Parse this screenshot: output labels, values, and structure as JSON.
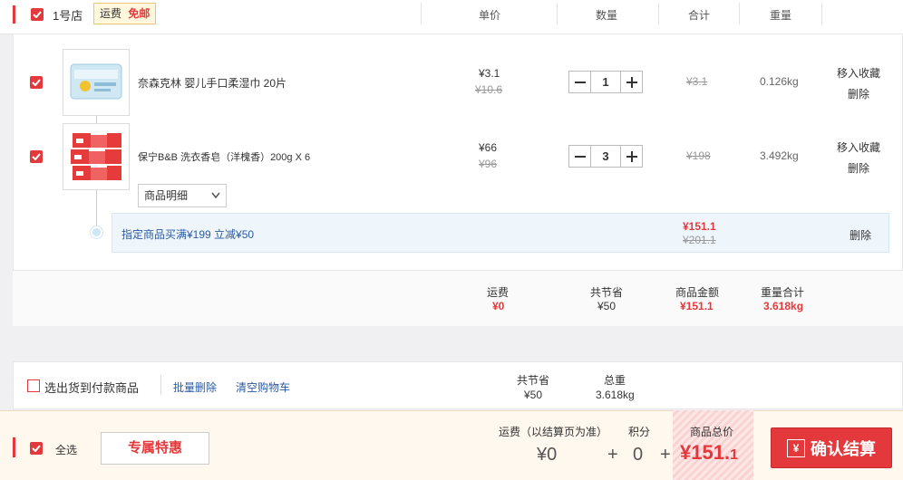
{
  "header": {
    "store_name": "1号店",
    "shipping_badge_label": "运费",
    "shipping_badge_value": "免邮",
    "col_price": "单价",
    "col_qty": "数量",
    "col_total": "合计",
    "col_weight": "重量"
  },
  "items": [
    {
      "name": "奈森克林 婴儿手口柔湿巾 20片",
      "price": "¥3.1",
      "orig_price": "¥10.6",
      "qty": "1",
      "total_strike": "¥3.1",
      "weight": "0.126kg",
      "fav_label": "移入收藏",
      "del_label": "删除"
    },
    {
      "name": "保宁B&B 洗衣香皂（洋槐香）200g X 6",
      "price": "¥66",
      "orig_price": "¥96",
      "qty": "3",
      "total_strike": "¥198",
      "weight": "3.492kg",
      "fav_label": "移入收藏",
      "del_label": "删除"
    }
  ],
  "detail_dropdown": "商品明细",
  "promo": {
    "text": "指定商品买满¥199 立减¥50",
    "price": "¥151.1",
    "orig_price": "¥201.1",
    "delete": "删除"
  },
  "store_summary": {
    "shipping_label": "运费",
    "shipping_value": "¥0",
    "saved_label": "共节省",
    "saved_value": "¥50",
    "amount_label": "商品金额",
    "amount_value": "¥151.1",
    "weight_label": "重量合计",
    "weight_value": "3.618kg"
  },
  "cod_bar": {
    "cod_label": "选出货到付款商品",
    "batch_delete": "批量删除",
    "clear_cart": "清空购物车",
    "saved_label": "共节省",
    "saved_value": "¥50",
    "weight_label": "总重",
    "weight_value": "3.618kg"
  },
  "footer": {
    "select_all": "全选",
    "exclusive_deal": "专属特惠",
    "shipping_label": "运费（以结算页为准）",
    "shipping_value": "¥0",
    "points_label": "积分",
    "points_value": "0",
    "plus": "+",
    "total_label": "商品总价",
    "total_main": "¥151.",
    "total_decimal": "1",
    "checkout_icon": "¥",
    "checkout_label": "确认结算"
  },
  "colors": {
    "accent": "#e4393c",
    "link": "#2b5aa0",
    "promo_bg": "#eef6fc"
  }
}
